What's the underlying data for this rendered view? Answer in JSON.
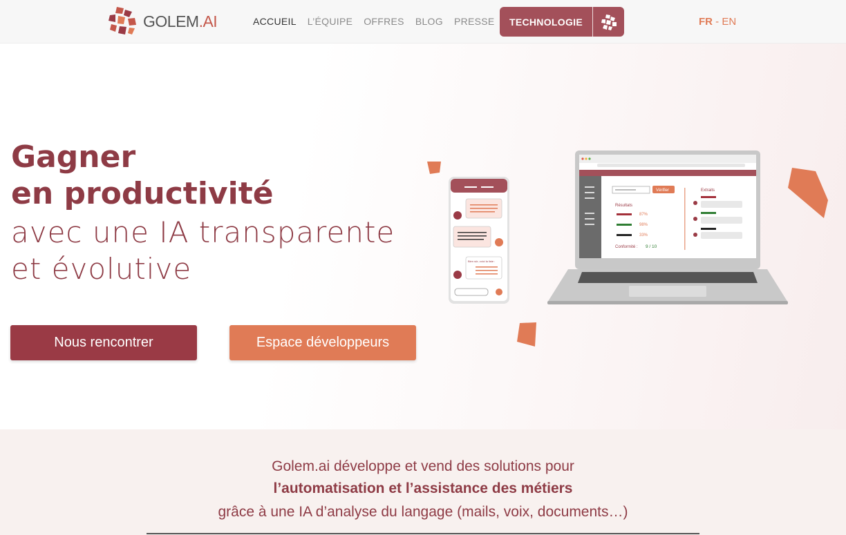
{
  "nav": {
    "logo_text": "GOLEM",
    "logo_suffix": ".AI",
    "items": [
      "ACCUEIL",
      "L’ÉQUIPE",
      "OFFRES",
      "BLOG",
      "PRESSE"
    ],
    "tech_label": "TECHNOLOGIE",
    "lang_fr": "FR",
    "lang_sep": " - ",
    "lang_en": "EN"
  },
  "hero": {
    "line1": "Gagner",
    "line2": "en productivité",
    "line3": "avec une IA transparente",
    "line4": "et évolutive",
    "btn_meet": "Nous rencontrer",
    "btn_dev": "Espace développeurs"
  },
  "illustration": {
    "verify_label": "Vérifier",
    "results_label": "Résultats",
    "extracts_label": "Extraits",
    "scores": [
      "87%",
      "98%",
      "33%"
    ],
    "conformity_label": "Conformité :",
    "conformity_value": "9 / 10",
    "chat_text": "Bien sûr, voici la liste :"
  },
  "intro": {
    "line1": "Golem.ai développe et vend des solutions pour",
    "line2": "l’automatisation et l’assistance des métiers",
    "line3": "grâce à une IA d’analyse du langage (mails, voix, documents…)"
  },
  "colors": {
    "brand": "#8e3b45",
    "accent": "#e07b56",
    "tech_btn": "#a3505a"
  }
}
